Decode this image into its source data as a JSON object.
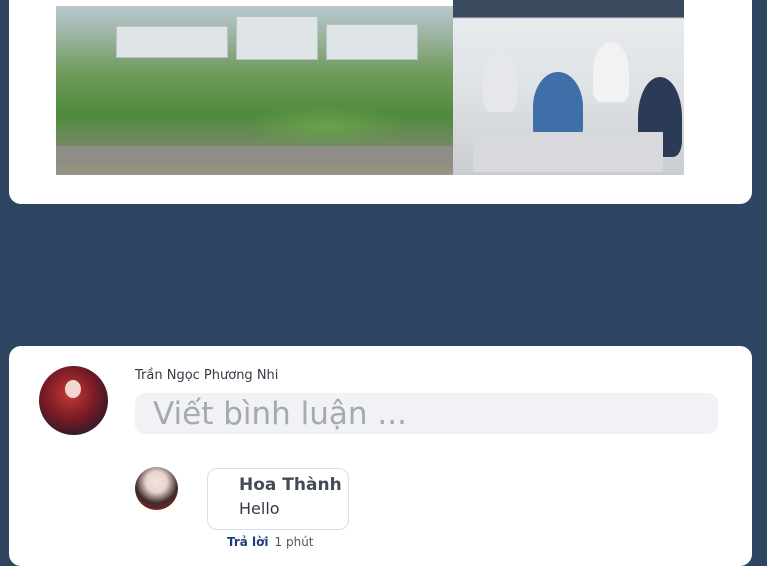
{
  "top_card": {
    "images": [
      {
        "name": "campus-aerial-photo"
      },
      {
        "name": "team-meeting-photo"
      }
    ]
  },
  "comments_section": {
    "current_user": "Trần Ngọc Phương Nhi",
    "input_placeholder": "Viết bình luận ...",
    "comments": [
      {
        "author": "Hoa Thành",
        "text": "Hello",
        "reply_label": "Trả lời",
        "time": "1 phút"
      }
    ]
  }
}
